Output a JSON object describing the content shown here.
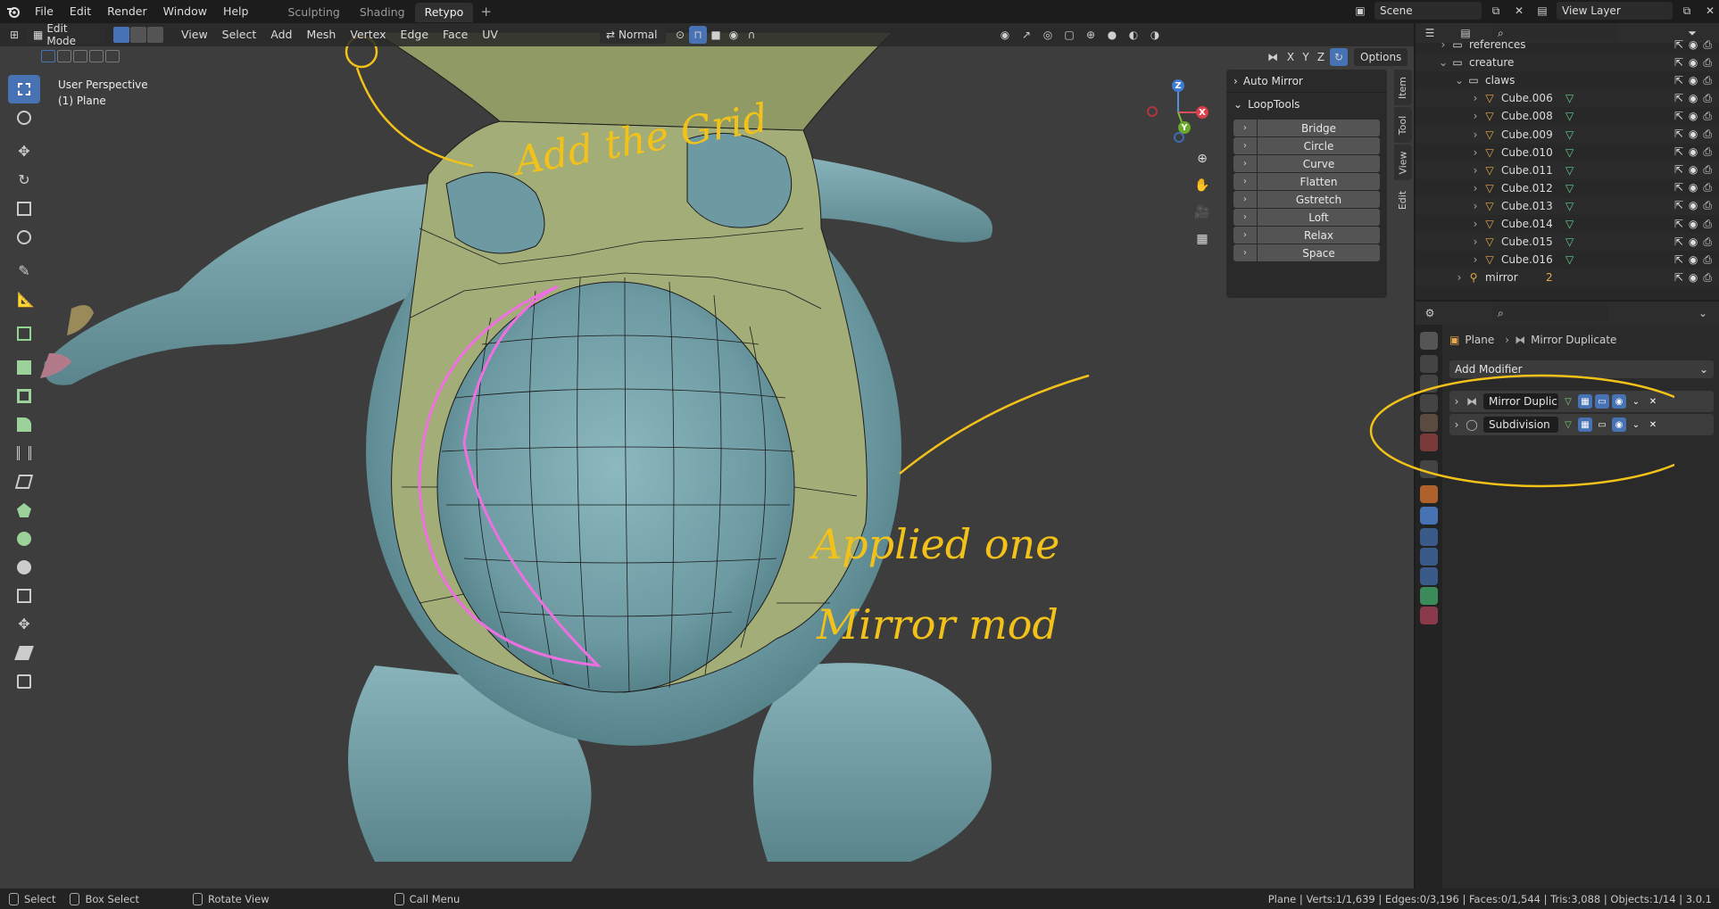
{
  "menu": {
    "items": [
      "File",
      "Edit",
      "Render",
      "Window",
      "Help"
    ],
    "workspace_tabs": [
      "Sculpting",
      "Shading",
      "Retypo"
    ],
    "active_workspace": "Retypo",
    "scene": "Scene",
    "view_layer": "View Layer"
  },
  "viewport": {
    "mode": "Edit Mode",
    "menus": [
      "View",
      "Select",
      "Add",
      "Mesh",
      "Vertex",
      "Edge",
      "Face",
      "UV"
    ],
    "orientation": "Normal",
    "mirror_axes": [
      "X",
      "Y",
      "Z"
    ],
    "options": "Options",
    "view_name": "User Perspective",
    "object_label": "(1) Plane",
    "gizmo_axes": {
      "x": "X",
      "y": "Y",
      "z": "Z"
    }
  },
  "npanel": {
    "auto_mirror": "Auto Mirror",
    "looptools": "LoopTools",
    "buttons": [
      "Bridge",
      "Circle",
      "Curve",
      "Flatten",
      "Gstretch",
      "Loft",
      "Relax",
      "Space"
    ],
    "tabs": [
      "Item",
      "Tool",
      "View",
      "Edit"
    ]
  },
  "annotations": {
    "add_the_grid": "Add the Grid",
    "applied_line1": "Applied one",
    "applied_line2": "Mirror mod"
  },
  "outliner": {
    "rows": [
      {
        "name": "references",
        "indent": 1
      },
      {
        "name": "creature",
        "indent": 1
      },
      {
        "name": "claws",
        "indent": 2
      },
      {
        "name": "Cube.006",
        "indent": 3
      },
      {
        "name": "Cube.008",
        "indent": 3
      },
      {
        "name": "Cube.009",
        "indent": 3
      },
      {
        "name": "Cube.010",
        "indent": 3
      },
      {
        "name": "Cube.011",
        "indent": 3
      },
      {
        "name": "Cube.012",
        "indent": 3
      },
      {
        "name": "Cube.013",
        "indent": 3
      },
      {
        "name": "Cube.014",
        "indent": 3
      },
      {
        "name": "Cube.015",
        "indent": 3
      },
      {
        "name": "Cube.016",
        "indent": 3
      },
      {
        "name": "mirror",
        "indent": 2
      }
    ],
    "mirror_count": "2"
  },
  "properties": {
    "breadcrumb_object": "Plane",
    "breadcrumb_modifier": "Mirror Duplicate",
    "add_modifier": "Add Modifier",
    "modifiers": [
      {
        "name": "Mirror Duplic..."
      },
      {
        "name": "Subdivision"
      }
    ]
  },
  "status": {
    "select": "Select",
    "box_select": "Box Select",
    "rotate_view": "Rotate View",
    "call_menu": "Call Menu",
    "stats": "Plane | Verts:1/1,639 | Edges:0/3,196 | Faces:0/1,544 | Tris:3,088 | Objects:1/14 | 3.0.1"
  }
}
